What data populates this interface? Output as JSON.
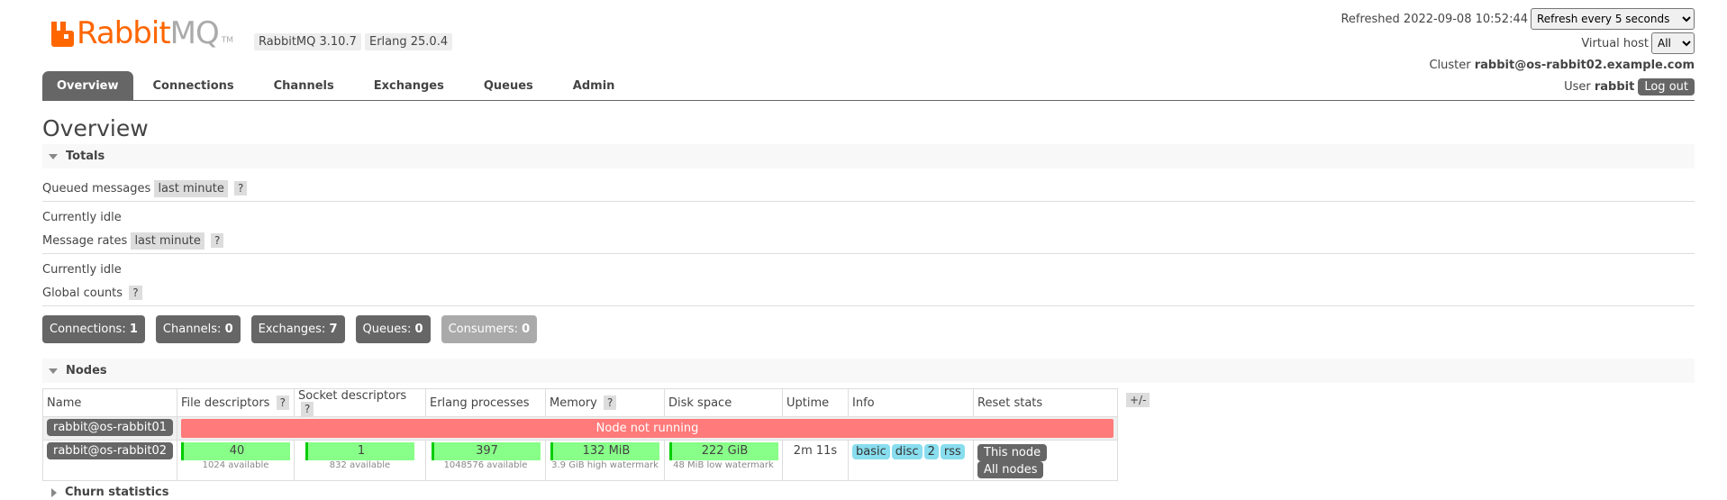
{
  "header": {
    "logo_word1": "Rabbit",
    "logo_word2": "MQ",
    "logo_tm": "TM",
    "version": "RabbitMQ 3.10.7",
    "erlang": "Erlang 25.0.4",
    "refreshed": "Refreshed 2022-09-08 10:52:44",
    "refresh_select": "Refresh every 5 seconds",
    "virtual_host_label": "Virtual host",
    "virtual_host_value": "All",
    "cluster_label": "Cluster",
    "cluster_value": "rabbit@os-rabbit02.example.com",
    "user_label": "User",
    "user_value": "rabbit",
    "logout": "Log out"
  },
  "tabs": [
    "Overview",
    "Connections",
    "Channels",
    "Exchanges",
    "Queues",
    "Admin"
  ],
  "page_title": "Overview",
  "totals": {
    "section_label": "Totals",
    "queued_label": "Queued messages",
    "queued_tag": "last minute",
    "help": "?",
    "idle1": "Currently idle",
    "rates_label": "Message rates",
    "rates_tag": "last minute",
    "idle2": "Currently idle",
    "global_label": "Global counts"
  },
  "counts": [
    {
      "label": "Connections:",
      "value": "1"
    },
    {
      "label": "Channels:",
      "value": "0"
    },
    {
      "label": "Exchanges:",
      "value": "7"
    },
    {
      "label": "Queues:",
      "value": "0"
    },
    {
      "label": "Consumers:",
      "value": "0"
    }
  ],
  "nodes": {
    "section_label": "Nodes",
    "columns": [
      "Name",
      "File descriptors",
      "Socket descriptors",
      "Erlang processes",
      "Memory",
      "Disk space",
      "Uptime",
      "Info",
      "Reset stats"
    ],
    "plusminus": "+/-",
    "row1": {
      "name": "rabbit@os-rabbit01",
      "status": "Node not running"
    },
    "row2": {
      "name": "rabbit@os-rabbit02",
      "fd": "40",
      "fd_sub": "1024 available",
      "sd": "1",
      "sd_sub": "832 available",
      "ep": "397",
      "ep_sub": "1048576 available",
      "mem": "132 MiB",
      "mem_sub": "3.9 GiB high watermark",
      "disk": "222 GiB",
      "disk_sub": "48 MiB low watermark",
      "uptime": "2m 11s",
      "info": [
        "basic",
        "disc",
        "2",
        "rss"
      ],
      "reset_this": "This node",
      "reset_all": "All nodes"
    }
  },
  "churn": {
    "section_label": "Churn statistics"
  }
}
